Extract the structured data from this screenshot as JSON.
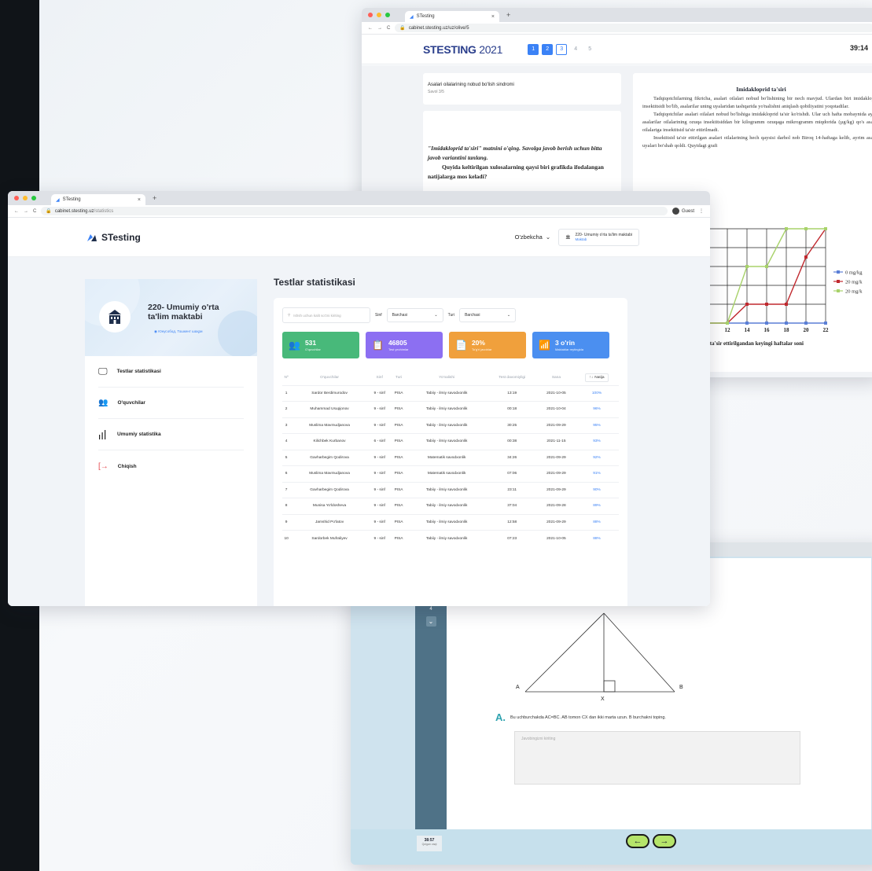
{
  "test_window_top": {
    "tab_title": "STesting",
    "url": "cabinet.stesting.uz/uz/olive/5",
    "logo_main": "STESTING",
    "logo_year": "2021",
    "pages": [
      "1",
      "2",
      "3",
      "4",
      "5"
    ],
    "timer": "39:14",
    "question_title": "Asalari oilalarining nobud bo'lish sindromi",
    "question_sub": "Savol 3/5",
    "instruction_1": "\"Imidakloprid ta'siri\" matnini o'qing. Savolga javob berish uchun bitta javob variantini tanlang.",
    "instruction_2": "Quyida keltirilgan xulosalarning qaysi biri grafikda ifodalangan natijalarga mos keladi?",
    "article_title": "Imidakloprid ta'siri",
    "article_p1": "Tadqiqotchilarning fikricha, asalari oilalari nobud bo'lishining bir nech mavjud. Ulardan biri imidakloprid insektitsidi bo'lib, asalarilar uning uyalaridan tashqarida yo'nalishni aniqlash qobiliyatini yoqotadilar.",
    "article_p2": "Tadqiqotchilar asalari oilalari nobud bo'lishiga imidakloprid ta'sir ko'rishdi. Ular uch hafta mobaynida ayrim asalarilar oilalarining ozuqa insektitsiddan bir kilogramm ozuqaga mikrogramm miqdorida (µg/kg) qo's asalari oilalariga insektitsid ta'sir ettirilmadi.",
    "article_p3": "Insektitsid ta'sir ettirilgan asalari oilalarining hech qaysisi darhol nob Biroq 14-haftaga kelib, ayrim asalari uyalari bo'shab qoldi. Quyidagi grafi",
    "chart_caption": "ktitsid ta'sir ettirilgandan keyingi haftalar soni",
    "legend": [
      "0 mg/kg",
      "20 mg/k",
      "20 mg/k"
    ],
    "x_ticks": [
      "12",
      "14",
      "16",
      "18",
      "20",
      "22"
    ],
    "colors": {
      "blue": "#5b7fd6",
      "red": "#c0292f",
      "green": "#a8d26a"
    }
  },
  "chart_data": {
    "type": "line",
    "title": "",
    "xlabel": "ktitsid ta'sir ettirilgandan keyingi haftalar soni",
    "ylabel": "",
    "x": [
      10,
      12,
      14,
      16,
      18,
      20,
      22
    ],
    "ylim": [
      0,
      100
    ],
    "series": [
      {
        "name": "0 mg/kg",
        "values": [
          0,
          0,
          0,
          0,
          0,
          0,
          0
        ]
      },
      {
        "name": "20 mg/k",
        "values": [
          0,
          0,
          20,
          20,
          20,
          70,
          100
        ]
      },
      {
        "name": "20 mg/k",
        "values": [
          0,
          0,
          60,
          60,
          100,
          100,
          100
        ]
      }
    ]
  },
  "test_window_bottom": {
    "question_number": "4",
    "vertex_a": "A",
    "vertex_b": "B",
    "vertex_x": "X",
    "answer_letter": "A.",
    "question_text": "Bu uchburchakda AC=BC. AB tomon CX dan ikki marta uzun. B burchakni toping.",
    "answer_placeholder": "Javobingizni kiriting",
    "timer": "38:57",
    "timer_sub": "Qolgan vaqt"
  },
  "dashboard": {
    "tab_title": "STesting",
    "url_host": "cabinet.stesting.uz",
    "url_path": "/statistics",
    "guest_label": "Guest",
    "brand": "STesting",
    "language": "O'zbekcha",
    "school_short": "220- Umumiy o'rta ta'lim maktabi",
    "school_role": "Maktab",
    "school_name": "220- Umumiy o'rta ta'lim maktabi",
    "school_location": "Юнусобод, Тошкент шаҳри",
    "menu": [
      "Testlar statistikasi",
      "O'quvchilar",
      "Umumiy statistika",
      "Chiqish"
    ],
    "page_title": "Testlar statistikasi",
    "search_placeholder": "Ishsh uchun kalit so'zni kiriting",
    "filter_class_label": "Sinf",
    "filter_class_value": "Barchasi",
    "filter_type_label": "Turi",
    "filter_type_value": "Barchasi",
    "stats": [
      {
        "num": "531",
        "label": "O'quvchilar",
        "color": "#48b97a"
      },
      {
        "num": "46805",
        "label": "Test yechimlar",
        "color": "#8c6ff2"
      },
      {
        "num": "20%",
        "label": "To'g'ri javoblar",
        "color": "#f0a03c"
      },
      {
        "num": "3 o'rin",
        "label": "Maktablar reytingida",
        "color": "#4b8ff0"
      }
    ],
    "table_headers": [
      "Nº",
      "O'quvchilar",
      "Sinf",
      "Turi",
      "Yo'nalishi",
      "Test davomiyligi",
      "Sana",
      "Natija"
    ],
    "rows": [
      [
        "1",
        "Sardor Berdimurodov",
        "9 - sinf",
        "PISA",
        "Tabiiy - ilmiy savodxonlik",
        "13:19",
        "2021-10-05",
        "100%"
      ],
      [
        "2",
        "Muhammad Usupjonov",
        "9 - sinf",
        "PISA",
        "Tabiiy - ilmiy savodxonlik",
        "00:18",
        "2021-10-04",
        "96%"
      ],
      [
        "3",
        "Muslima Mavmudjanova",
        "9 - sinf",
        "PISA",
        "Tabiiy - ilmiy savodxonlik",
        "30:25",
        "2021-09-29",
        "95%"
      ],
      [
        "4",
        "Kilichbek Kurbanov",
        "6 - sinf",
        "PISA",
        "Tabiiy - ilmiy savodxonlik",
        "00:38",
        "2021-11-15",
        "93%"
      ],
      [
        "5",
        "Gavharbegim Qodirova",
        "9 - sinf",
        "PISA",
        "Matematik savodxonlik",
        "34:26",
        "2021-09-29",
        "92%"
      ],
      [
        "6",
        "Muslima Mavmudjanova",
        "9 - sinf",
        "PISA",
        "Matematik savodxonlik",
        "07:06",
        "2021-09-29",
        "91%"
      ],
      [
        "7",
        "Gavharbegim Qodirova",
        "9 - sinf",
        "PISA",
        "Tabiiy - ilmiy savodxonlik",
        "23:11",
        "2021-09-29",
        "90%"
      ],
      [
        "8",
        "Munisa Yo'ldosheva",
        "9 - sinf",
        "PISA",
        "Tabiiy - ilmiy savodxonlik",
        "37:04",
        "2021-09-28",
        "89%"
      ],
      [
        "9",
        "Jamshid Po'latov",
        "9 - sinf",
        "PISA",
        "Tabiiy - ilmiy savodxonlik",
        "12:58",
        "2021-09-29",
        "88%"
      ],
      [
        "10",
        "Sardorbek Mufraliyev",
        "9 - sinf",
        "PISA",
        "Tabiiy - ilmiy savodxonlik",
        "07:23",
        "2021-10-05",
        "88%"
      ]
    ]
  }
}
